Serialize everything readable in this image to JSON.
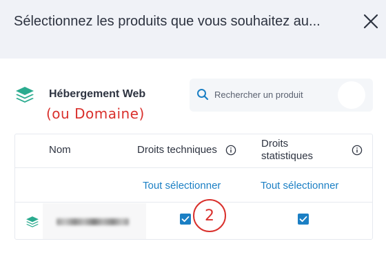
{
  "dialog": {
    "title": "Sélectionnez les produits que vous souhaitez au..."
  },
  "product": {
    "name": "Hébergement Web",
    "annotation": "(ou Domaine)"
  },
  "search": {
    "placeholder": "Rechercher un produit",
    "value": ""
  },
  "table": {
    "headers": {
      "name": "Nom",
      "technical_rights": "Droits techniques",
      "statistical_rights_line1": "Droits",
      "statistical_rights_line2": "statistiques"
    },
    "select_all_technical": "Tout sélectionner",
    "select_all_statistical": "Tout sélectionner",
    "rows": [
      {
        "technical_checked": true,
        "statistical_checked": true
      }
    ]
  },
  "step_badge": "2",
  "colors": {
    "accent": "#1b7fc4",
    "annotation": "#d9302c",
    "product_icon": "#2bab8f",
    "header_bg": "#f0f2f7"
  }
}
